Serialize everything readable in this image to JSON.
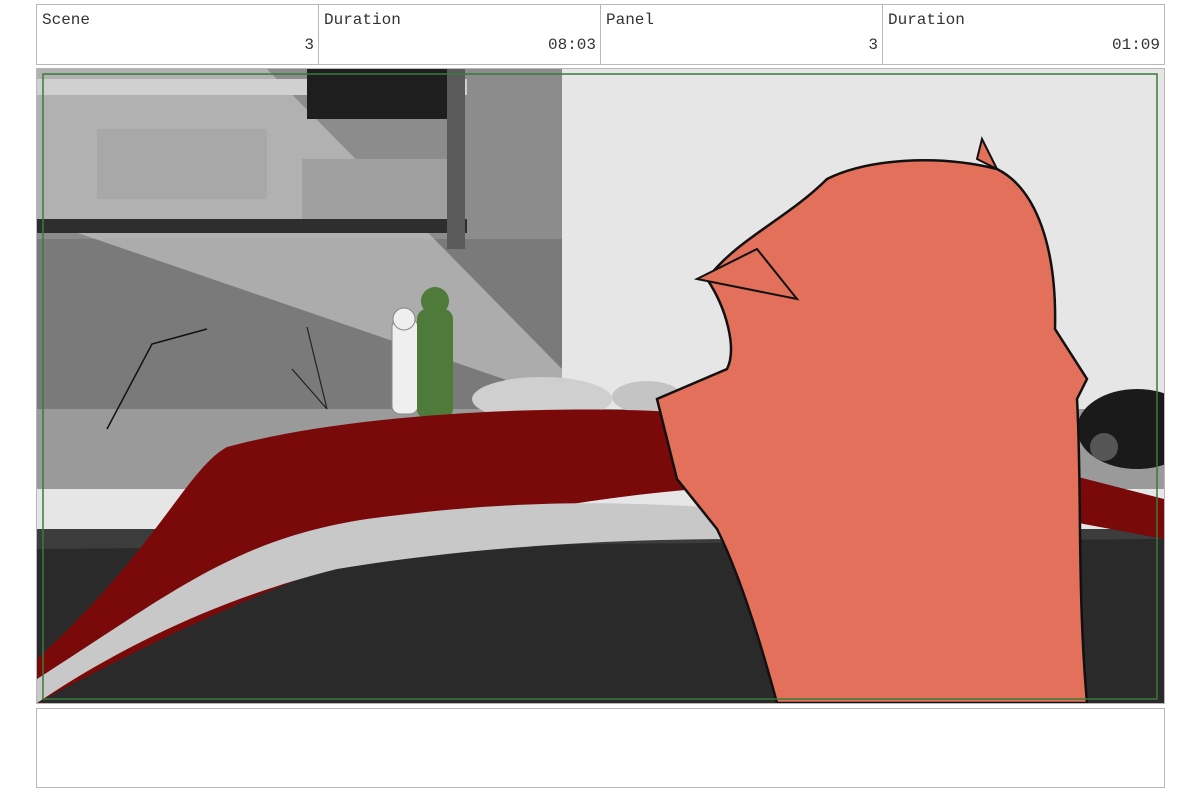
{
  "header": {
    "scene_label": "Scene",
    "scene_value": "3",
    "scene_duration_label": "Duration",
    "scene_duration_value": "08:03",
    "panel_label": "Panel",
    "panel_value": "3",
    "panel_duration_label": "Duration",
    "panel_duration_value": "01:09"
  },
  "panel": {
    "safe_frame_color": "#3a7a3a",
    "character_color": "#e2705a",
    "car_color": "#7a0a0a"
  },
  "notes": {
    "text": ""
  }
}
